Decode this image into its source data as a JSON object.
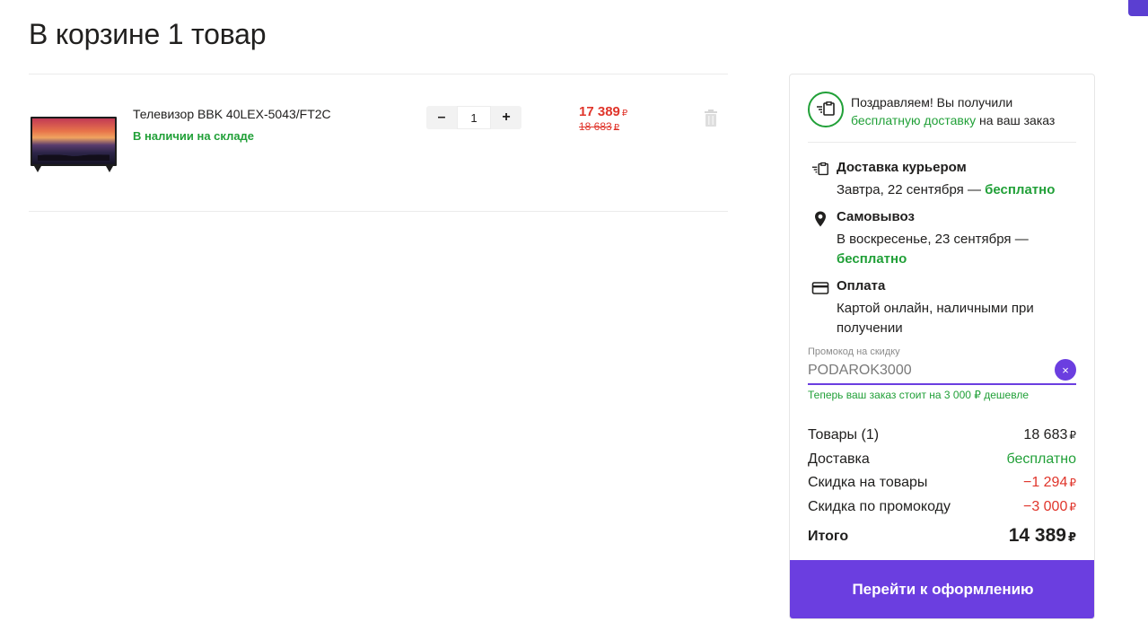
{
  "page": {
    "title": "В корзине 1 товар"
  },
  "cart": {
    "items": [
      {
        "name": "Телевизор BBK 40LEX-5043/FT2C",
        "stock": "В наличии на складе",
        "qty_minus": "–",
        "qty_plus": "+",
        "quantity": "1",
        "price_current": "17 389",
        "price_old": "18 683",
        "currency": "₽",
        "image_icon": "tv-product-image",
        "delete_icon": "trash-icon"
      }
    ]
  },
  "summary": {
    "banner": {
      "line1": "Поздравляем! Вы получили",
      "link": "бесплатную доставку",
      "rest": " на ваш заказ",
      "icon": "delivery-icon"
    },
    "delivery": {
      "title": "Доставка курьером",
      "text": "Завтра, 22 сентября — ",
      "free": "бесплатно",
      "icon": "courier-icon"
    },
    "pickup": {
      "title": "Самовывоз",
      "text": "В воскресенье, 23 сентября — ",
      "free": "бесплатно",
      "icon": "location-pin-icon"
    },
    "payment": {
      "title": "Оплата",
      "text": "Картой онлайн, наличными при получении",
      "icon": "credit-card-icon"
    },
    "promo": {
      "label": "Промокод на скидку",
      "value": "PODAROK3000",
      "clear_icon": "×",
      "success": "Теперь ваш заказ стоит на 3 000 ₽ дешевле"
    },
    "totals": {
      "goods_label": "Товары (1)",
      "goods_value": "18 683",
      "delivery_label": "Доставка",
      "delivery_value": "бесплатно",
      "discount_label": "Скидка на товары",
      "discount_value": "−1 294",
      "promo_label": "Скидка по промокоду",
      "promo_value": "−3 000",
      "total_label": "Итого",
      "total_value": "14 389",
      "currency": "₽"
    },
    "checkout_label": "Перейти к оформлению"
  },
  "colors": {
    "accent": "#6b3ee0",
    "green": "#21a038",
    "red": "#e0352b"
  }
}
